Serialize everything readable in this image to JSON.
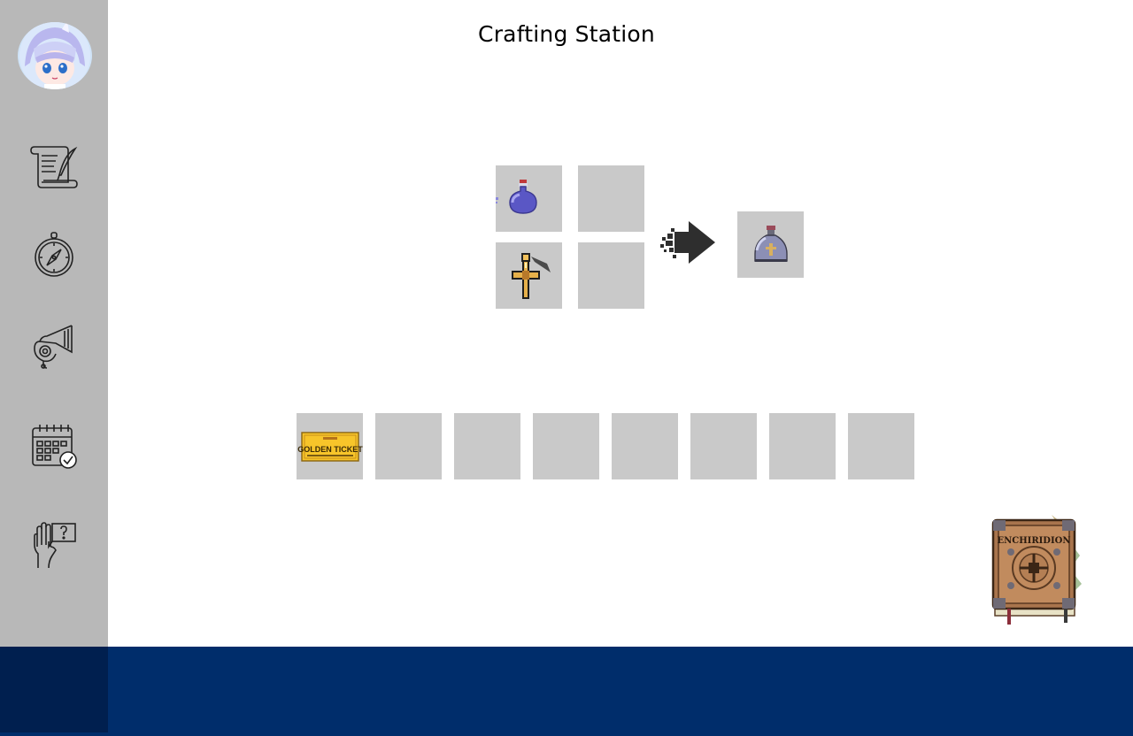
{
  "window": {
    "title": "Crafting Station"
  },
  "sidebar": {
    "avatar": "avatar",
    "items": [
      {
        "icon": "scroll-quill-icon"
      },
      {
        "icon": "compass-icon"
      },
      {
        "icon": "horn-icon"
      },
      {
        "icon": "calendar-check-icon"
      },
      {
        "icon": "hand-help-icon"
      }
    ]
  },
  "crafting": {
    "input_slots": [
      {
        "item": "purple-potion"
      },
      {
        "item": ""
      },
      {
        "item": "golden-cross"
      },
      {
        "item": ""
      }
    ],
    "arrow_icon": "pixel-arrow-right-icon",
    "output_slot": {
      "item": "holy-water-bottle"
    }
  },
  "inventory": {
    "slots": [
      {
        "item": "golden-ticket",
        "text_main": "GOLDEN TICKET"
      },
      {
        "item": ""
      },
      {
        "item": ""
      },
      {
        "item": ""
      },
      {
        "item": ""
      },
      {
        "item": ""
      },
      {
        "item": ""
      },
      {
        "item": ""
      }
    ]
  },
  "enchiridion": {
    "icon": "enchiridion-book-icon",
    "cover_text": "ENCHIRIDION"
  },
  "colors": {
    "sidebar": "#b8b8b8",
    "slot": "#c9c9c9",
    "bottom_bar": "#002d6b",
    "bottom_bar_side": "#001f4f"
  }
}
